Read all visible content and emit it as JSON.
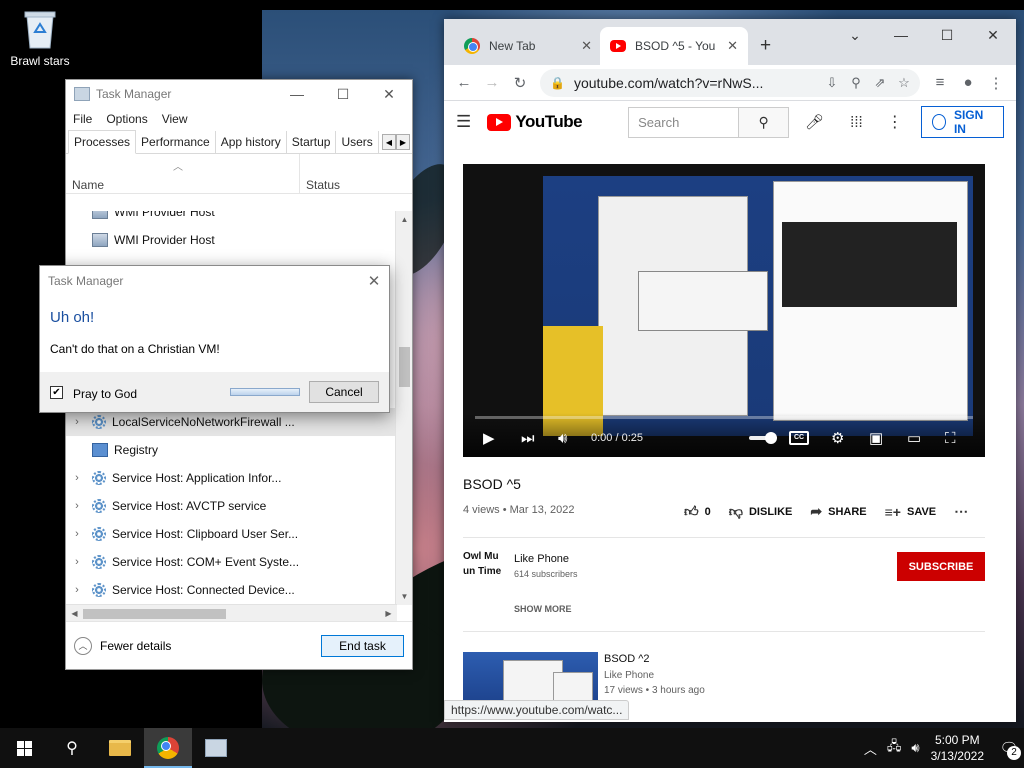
{
  "desktop": {
    "icon_label": "Brawl stars"
  },
  "task_manager": {
    "title": "Task Manager",
    "menu": [
      "File",
      "Options",
      "View"
    ],
    "tabs": [
      "Processes",
      "Performance",
      "App history",
      "Startup",
      "Users"
    ],
    "active_tab": "Processes",
    "columns": {
      "name": "Name",
      "status": "Status"
    },
    "rows_top": [
      {
        "label": "WMI Provider Host",
        "icon": "wmi-icon"
      },
      {
        "label": "WMI Provider Host",
        "icon": "wmi-icon"
      }
    ],
    "rows_bottom": [
      {
        "label": "LocalServiceNoNetworkFirewall ...",
        "icon": "gear-icon",
        "expandable": true,
        "selected": true
      },
      {
        "label": "Registry",
        "icon": "registry-icon",
        "expandable": false
      },
      {
        "label": "Service Host: Application Infor...",
        "icon": "gear-icon",
        "expandable": true
      },
      {
        "label": "Service Host: AVCTP service",
        "icon": "gear-icon",
        "expandable": true
      },
      {
        "label": "Service Host: Clipboard User Ser...",
        "icon": "gear-icon",
        "expandable": true
      },
      {
        "label": "Service Host: COM+ Event Syste...",
        "icon": "gear-icon",
        "expandable": true
      },
      {
        "label": "Service Host: Connected Device...",
        "icon": "gear-icon",
        "expandable": true
      }
    ],
    "fewer_details": "Fewer details",
    "end_task": "End task"
  },
  "dialog": {
    "title": "Task Manager",
    "heading": "Uh oh!",
    "message": "Can't do that on a Christian VM!",
    "checkbox_label": "Pray to God",
    "checkbox_checked": true,
    "cancel": "Cancel"
  },
  "chrome": {
    "tabs": [
      {
        "title": "New Tab",
        "icon": "chrome-icon",
        "active": false
      },
      {
        "title": "BSOD ^5 - You",
        "icon": "youtube-icon",
        "active": true
      }
    ],
    "url": "youtube.com/watch?v=rNwS...",
    "status_url": "https://www.youtube.com/watc..."
  },
  "youtube": {
    "logo_text": "YouTube",
    "search_placeholder": "Search",
    "sign_in": "SIGN IN",
    "player": {
      "time": "0:00 / 0:25",
      "cc": "CC"
    },
    "video_title": "BSOD ^5",
    "video_meta": "4 views • Mar 13, 2022",
    "likes": "0",
    "dislike": "DISLIKE",
    "share": "SHARE",
    "save": "SAVE",
    "channel_avatar_text": [
      "Owl Mu",
      "un Time"
    ],
    "channel_name": "Like Phone",
    "channel_subs": "614 subscribers",
    "subscribe": "SUBSCRIBE",
    "show_more": "SHOW MORE",
    "related": {
      "title": "BSOD ^2",
      "channel": "Like Phone",
      "meta": "17 views • 3 hours ago"
    }
  },
  "taskbar": {
    "time": "5:00 PM",
    "date": "3/13/2022",
    "notification_count": "2"
  }
}
